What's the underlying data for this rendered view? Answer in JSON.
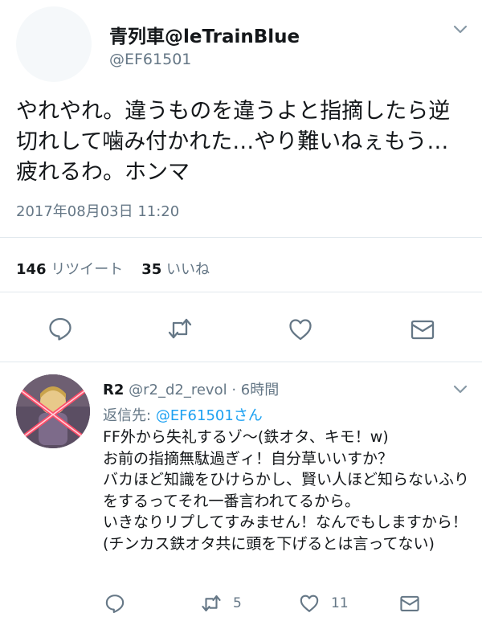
{
  "tweet": {
    "display_name": "青列車@leTrainBlue",
    "handle": "@EF61501",
    "text": "やれやれ。違うものを違うよと指摘したら逆切れして噛み付かれた…やり難いねぇもう…疲れるわ。ホンマ",
    "timestamp": "2017年08月03日 11:20",
    "retweet_count": "146",
    "retweet_label": "リツイート",
    "like_count": "35",
    "like_label": "いいね"
  },
  "reply": {
    "display_name": "R2",
    "handle_time": "@r2_d2_revol · 6時間",
    "replying_label": "返信先:",
    "replying_to": "@EF61501さん",
    "text": "FF外から失礼するゾ〜(鉄オタ、キモ！w)\nお前の指摘無駄過ぎィ！自分草いいすか？\nバカほど知識をひけらかし、賢い人ほど知らないふりをするってそれ一番言われてるから。\nいきなりリプしてすみません！なんでもしますから！(チンカス鉄オタ共に頭を下げるとは言ってない)",
    "retweet_count": "5",
    "like_count": "11"
  },
  "colors": {
    "text": "#14171a",
    "muted": "#657786",
    "accent": "#1da1f2",
    "divider": "#e1e8ed"
  },
  "icons": [
    "reply-icon",
    "retweet-icon",
    "like-icon",
    "dm-icon",
    "chevron-down-icon"
  ]
}
